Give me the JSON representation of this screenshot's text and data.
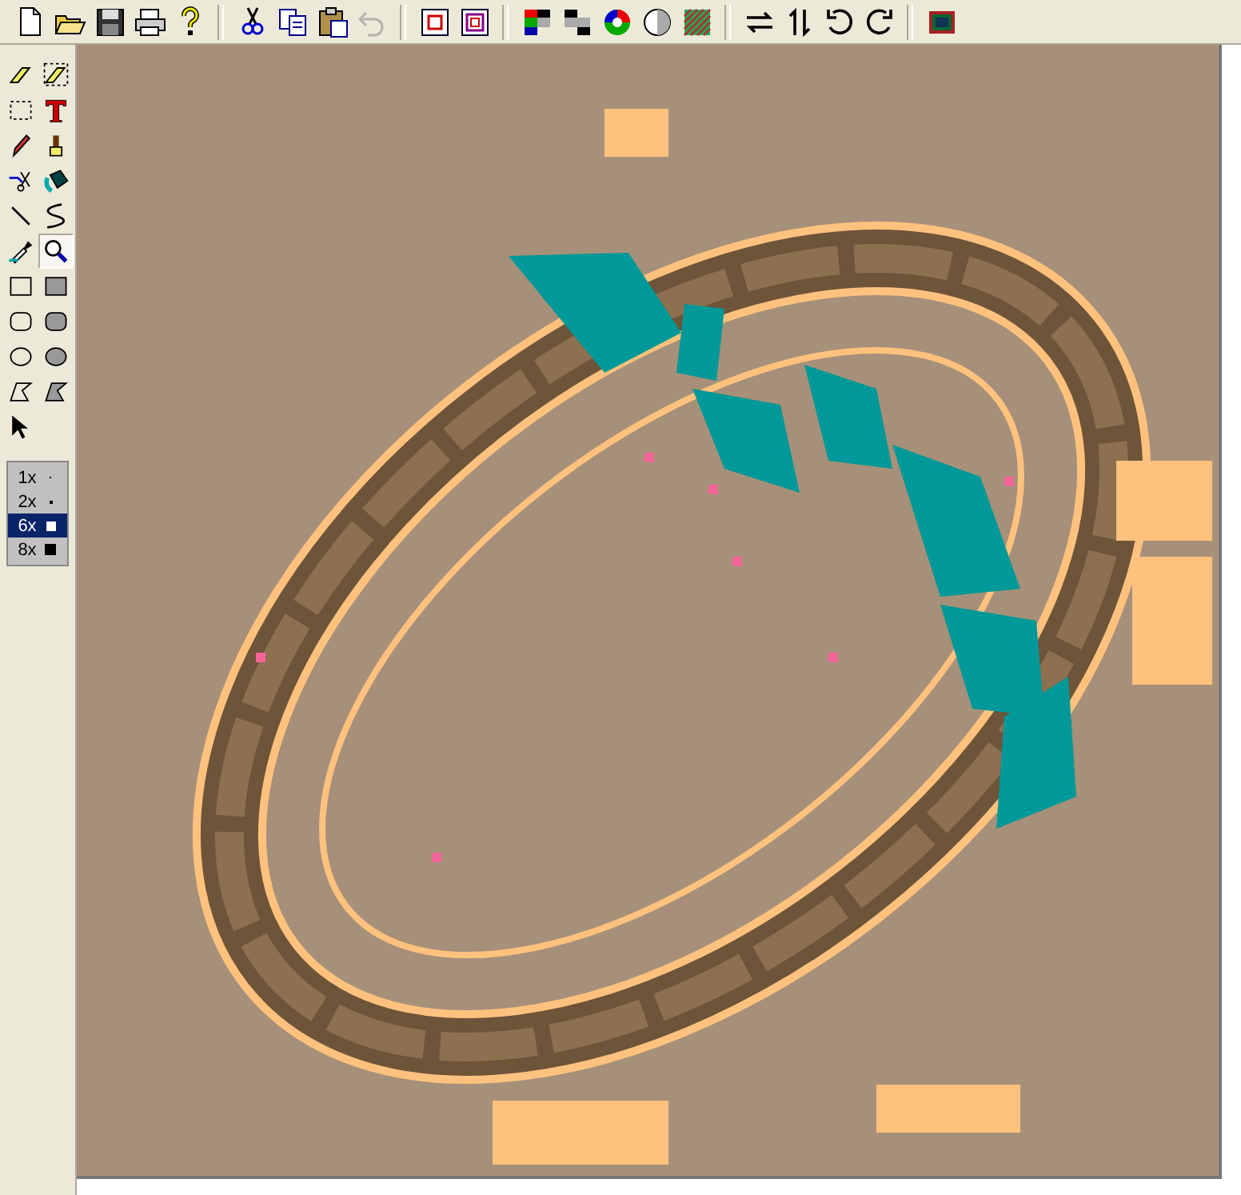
{
  "toolbar": [
    {
      "disabled": false
    },
    {
      "disabled": false
    },
    {
      "disabled": false
    },
    {
      "disabled": false
    },
    {
      "disabled": false
    },
    {
      "disabled": false
    },
    {
      "disabled": false
    },
    {
      "disabled": false
    },
    {
      "disabled": true
    },
    {
      "disabled": false
    },
    {
      "disabled": false
    },
    {
      "disabled": false
    },
    {
      "disabled": false
    },
    {
      "disabled": false
    },
    {
      "disabled": false
    },
    {
      "disabled": false
    },
    {
      "disabled": false
    },
    {
      "disabled": false
    },
    {
      "disabled": false
    },
    {
      "disabled": false
    },
    {
      "disabled": false
    }
  ],
  "tools": [
    {
      "selected": false
    },
    {
      "selected": false
    },
    {
      "selected": false
    },
    {
      "selected": false
    },
    {
      "selected": false
    },
    {
      "selected": false
    },
    {
      "selected": false
    },
    {
      "selected": false
    },
    {
      "selected": false
    },
    {
      "selected": false
    },
    {
      "selected": false
    },
    {
      "selected": true
    },
    {
      "selected": false
    },
    {
      "selected": false
    },
    {
      "selected": false
    },
    {
      "selected": false
    },
    {
      "selected": false
    },
    {
      "selected": false
    },
    {
      "selected": false
    },
    {
      "selected": false
    },
    {
      "selected": false
    }
  ],
  "zoom_options": [
    {
      "label": "1x",
      "selected": false
    },
    {
      "label": "2x",
      "selected": false
    },
    {
      "label": "6x",
      "selected": true
    },
    {
      "label": "8x",
      "selected": false
    }
  ]
}
